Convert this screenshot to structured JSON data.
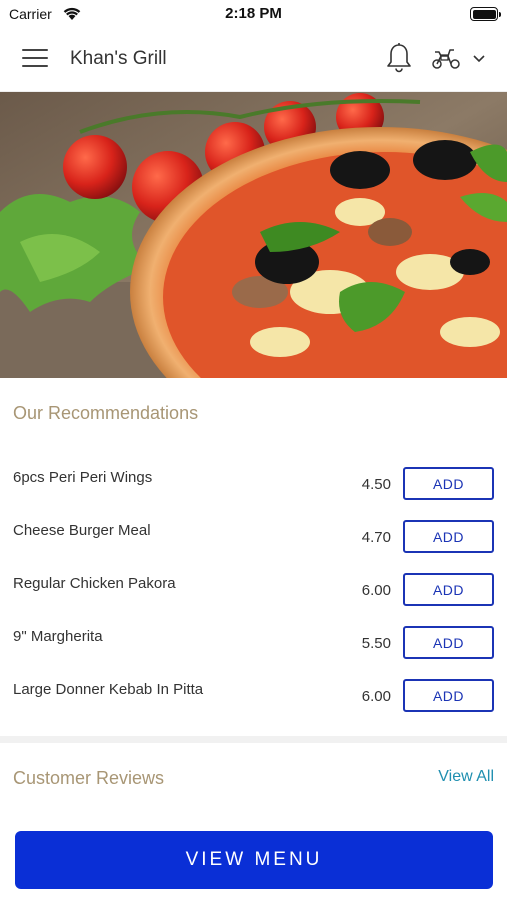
{
  "status_bar": {
    "carrier": "Carrier",
    "time": "2:18 PM"
  },
  "header": {
    "title": "Khan's Grill",
    "icons": [
      "menu-icon",
      "bell-icon",
      "scooter-icon",
      "chevron-down-icon"
    ]
  },
  "recommendations": {
    "title": "Our Recommendations",
    "add_label": "ADD",
    "items": [
      {
        "name": "6pcs Peri Peri Wings",
        "price": "4.50"
      },
      {
        "name": "Cheese Burger Meal",
        "price": "4.70"
      },
      {
        "name": "Regular Chicken Pakora",
        "price": "6.00"
      },
      {
        "name": "9\" Margherita",
        "price": "5.50"
      },
      {
        "name": "Large Donner Kebab In Pitta",
        "price": "6.00"
      }
    ]
  },
  "reviews": {
    "title": "Customer Reviews",
    "view_all": "View All"
  },
  "footer": {
    "view_menu": "VIEW MENU"
  },
  "colors": {
    "accent_blue": "#0a2fd6",
    "add_border": "#1b34b5",
    "section_title": "#a89675",
    "link": "#1f8fb0"
  }
}
